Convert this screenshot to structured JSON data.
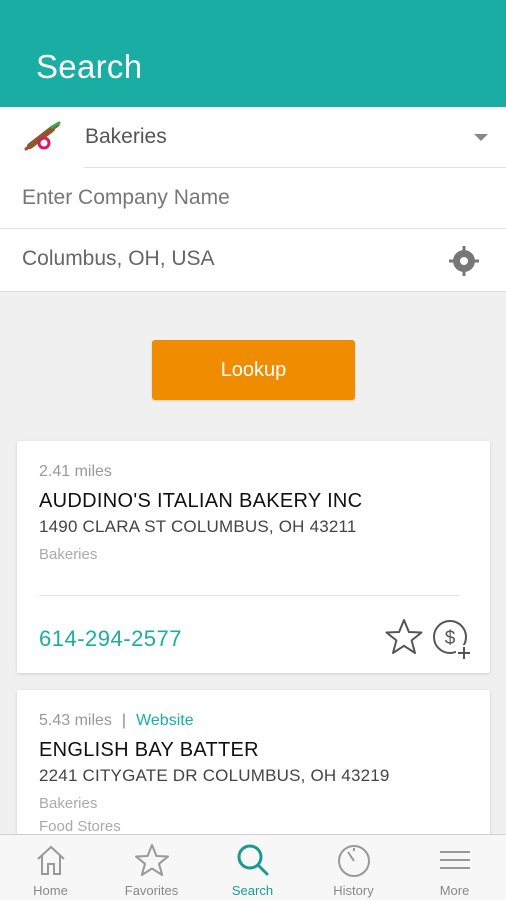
{
  "header": {
    "title": "Search"
  },
  "form": {
    "category": {
      "label": "Bakeries",
      "icon": "rolling-pin-icon"
    },
    "company": {
      "placeholder": "Enter Company Name",
      "value": ""
    },
    "location": {
      "value": "Columbus, OH, USA",
      "icon": "locate-icon"
    }
  },
  "lookup_label": "Lookup",
  "results": [
    {
      "distance": "2.41 miles",
      "name": "AUDDINO'S ITALIAN BAKERY INC",
      "address": "1490 CLARA ST COLUMBUS, OH 43211",
      "categories": [
        "Bakeries"
      ],
      "phone": "614-294-2577"
    },
    {
      "distance": "5.43 miles",
      "separator": "|",
      "website": "Website",
      "name": "ENGLISH BAY BATTER",
      "address": "2241 CITYGATE DR COLUMBUS, OH 43219",
      "categories": [
        "Bakeries",
        "Food Stores"
      ]
    }
  ],
  "tabs": [
    {
      "label": "Home",
      "icon": "home-icon"
    },
    {
      "label": "Favorites",
      "icon": "star-icon"
    },
    {
      "label": "Search",
      "icon": "search-icon",
      "active": true
    },
    {
      "label": "History",
      "icon": "history-icon"
    },
    {
      "label": "More",
      "icon": "menu-icon"
    }
  ],
  "colors": {
    "teal": "#1aada3",
    "orange": "#f08c00"
  }
}
